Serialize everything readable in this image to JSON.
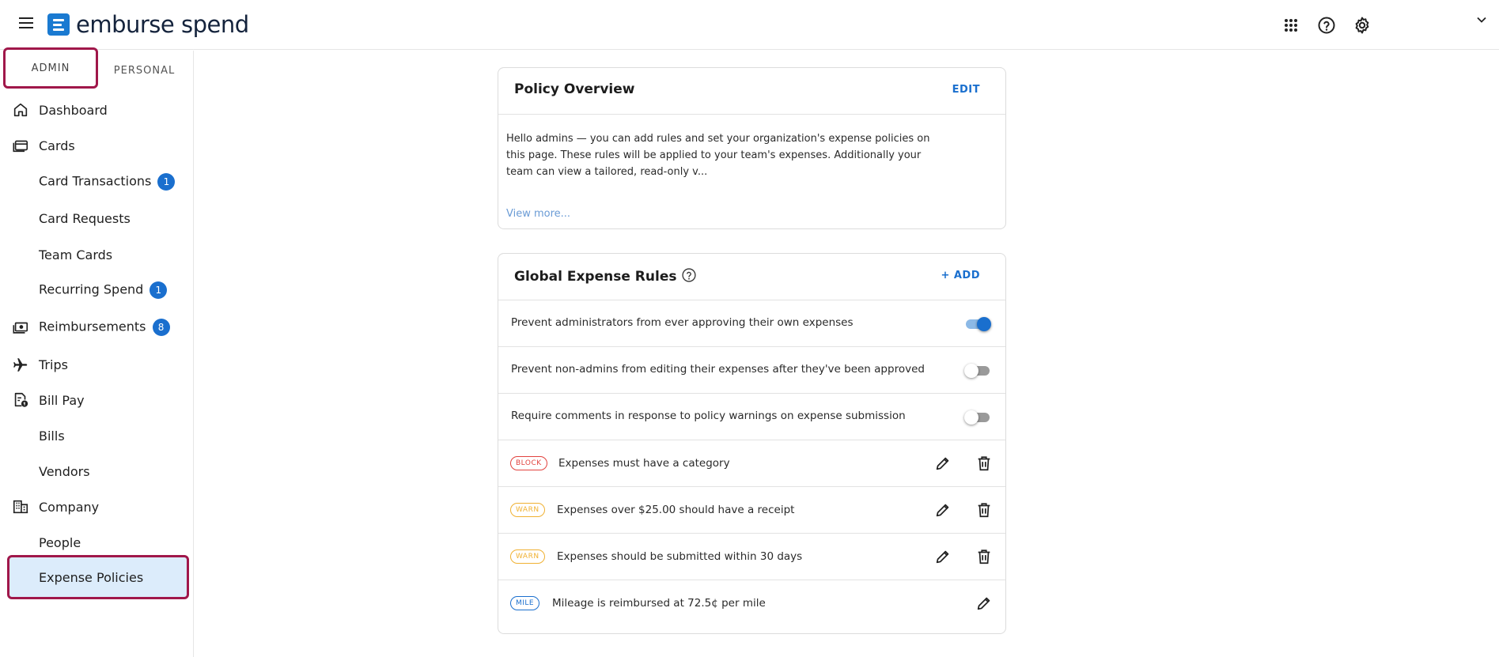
{
  "app": {
    "brand": "emburse spend",
    "brand_color": "#1a7ad1",
    "accent_color": "#1a6fce",
    "highlight_color": "#a0174a"
  },
  "header": {
    "icons": [
      "menu-icon",
      "apps-grid-icon",
      "help-circle-icon",
      "gear-icon",
      "chevron-down-icon"
    ]
  },
  "sidebar": {
    "tabs": [
      {
        "label": "ADMIN",
        "active": true
      },
      {
        "label": "PERSONAL",
        "active": false
      }
    ],
    "items": [
      {
        "label": "Dashboard",
        "icon": "home-icon"
      },
      {
        "label": "Cards",
        "icon": "cards-icon"
      },
      {
        "label": "Card Transactions",
        "badge": "1"
      },
      {
        "label": "Card Requests"
      },
      {
        "label": "Team Cards"
      },
      {
        "label": "Recurring Spend",
        "badge": "1"
      },
      {
        "label": "Reimbursements",
        "icon": "cash-icon",
        "badge": "8"
      },
      {
        "label": "Trips",
        "icon": "plane-icon"
      },
      {
        "label": "Bill Pay",
        "icon": "bill-icon"
      },
      {
        "label": "Bills"
      },
      {
        "label": "Vendors"
      },
      {
        "label": "Company",
        "icon": "building-icon"
      },
      {
        "label": "People"
      },
      {
        "label": "Expense Policies",
        "active": true
      }
    ]
  },
  "overview": {
    "title": "Policy Overview",
    "action": "EDIT",
    "body": "Hello admins — you can add rules and set your organization's expense policies on this page. These rules will be applied to your team's expenses. Additionally your team can view a tailored, read-only v...",
    "view_more": "View more..."
  },
  "rules": {
    "title": "Global Expense Rules",
    "action": "+ ADD",
    "toggles": [
      {
        "label": "Prevent administrators from ever approving their own expenses",
        "on": true
      },
      {
        "label": "Prevent non-admins from editing their expenses after they've been approved",
        "on": false
      },
      {
        "label": "Require comments in response to policy warnings on expense submission",
        "on": false
      }
    ],
    "items": [
      {
        "tag": "BLOCK",
        "text": "Expenses must have a category",
        "deletable": true
      },
      {
        "tag": "WARN",
        "text": "Expenses over $25.00 should have a receipt",
        "deletable": true
      },
      {
        "tag": "WARN",
        "text": "Expenses should be submitted within 30 days",
        "deletable": true
      },
      {
        "tag": "MILE",
        "text": "Mileage is reimbursed at 72.5¢ per mile",
        "deletable": false
      }
    ]
  }
}
